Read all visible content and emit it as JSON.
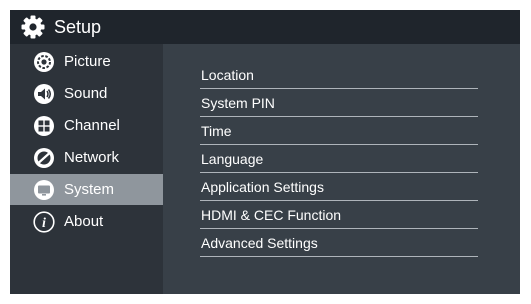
{
  "header": {
    "title": "Setup",
    "icon": "gear-icon"
  },
  "sidebar": {
    "items": [
      {
        "label": "Picture",
        "icon": "picture-settings-icon"
      },
      {
        "label": "Sound",
        "icon": "speaker-icon"
      },
      {
        "label": "Channel",
        "icon": "grid-icon"
      },
      {
        "label": "Network",
        "icon": "network-icon"
      },
      {
        "label": "System",
        "icon": "monitor-icon",
        "selected": true
      },
      {
        "label": "About",
        "icon": "info-icon"
      }
    ]
  },
  "menu": {
    "items": [
      {
        "label": "Location"
      },
      {
        "label": "System PIN"
      },
      {
        "label": "Time"
      },
      {
        "label": "Language"
      },
      {
        "label": "Application Settings"
      },
      {
        "label": "HDMI & CEC Function"
      },
      {
        "label": "Advanced Settings"
      }
    ]
  },
  "colors": {
    "title_bar": "#1f252c",
    "sidebar_bg": "#2d333a",
    "content_bg": "#384048",
    "selected_bg": "#8f969d",
    "divider": "#aeb4ba",
    "text": "#ffffff"
  }
}
